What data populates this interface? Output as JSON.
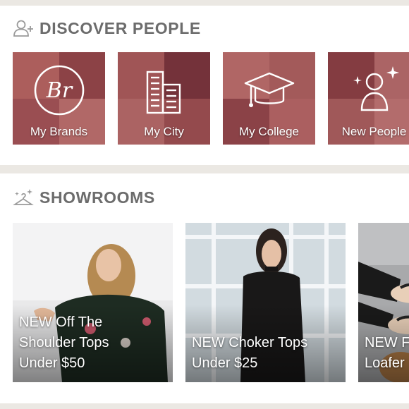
{
  "discover": {
    "title": "DISCOVER PEOPLE",
    "header_icon": "add-person-icon",
    "tiles": [
      {
        "label": "My Brands",
        "icon": "brand-monogram-icon",
        "monogram": "Br"
      },
      {
        "label": "My City",
        "icon": "city-buildings-icon"
      },
      {
        "label": "My College",
        "icon": "graduation-cap-icon"
      },
      {
        "label": "New People",
        "icon": "sparkle-person-icon"
      }
    ]
  },
  "showrooms": {
    "title": "SHOWROOMS",
    "header_icon": "sparkle-hanger-icon",
    "items": [
      {
        "label": "NEW Off The\nShoulder Tops\nUnder $50"
      },
      {
        "label": "NEW Choker Tops\nUnder $25"
      },
      {
        "label": "NEW F\nLoafer"
      }
    ]
  },
  "colors": {
    "background": "#ebe8e3",
    "card": "#ffffff",
    "header_text": "#6c6c6c",
    "tile_overlay": "#8c283c"
  }
}
